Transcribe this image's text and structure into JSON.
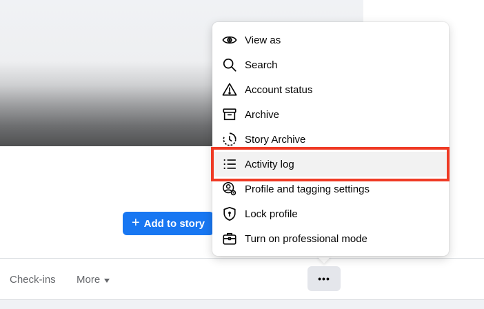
{
  "profile": {
    "add_story_label": "Add to story",
    "add_story_icon": "plus-icon"
  },
  "tabs": {
    "checkins_label": "Check-ins",
    "more_label": "More",
    "overflow_icon": "ellipsis-icon",
    "overflow_glyph": "•••"
  },
  "menu": {
    "items": [
      {
        "label": "View as",
        "icon": "eye-icon"
      },
      {
        "label": "Search",
        "icon": "search-icon"
      },
      {
        "label": "Account status",
        "icon": "warning-triangle-icon"
      },
      {
        "label": "Archive",
        "icon": "archive-box-icon"
      },
      {
        "label": "Story Archive",
        "icon": "story-archive-clock-icon"
      },
      {
        "label": "Activity log",
        "icon": "list-icon",
        "highlighted": true
      },
      {
        "label": "Profile and tagging settings",
        "icon": "profile-gear-icon"
      },
      {
        "label": "Lock profile",
        "icon": "lock-shield-icon"
      },
      {
        "label": "Turn on professional mode",
        "icon": "briefcase-icon"
      }
    ]
  },
  "colors": {
    "accent": "#1877f2",
    "highlight_border": "#ef3a24",
    "secondary_text": "#65676b"
  }
}
